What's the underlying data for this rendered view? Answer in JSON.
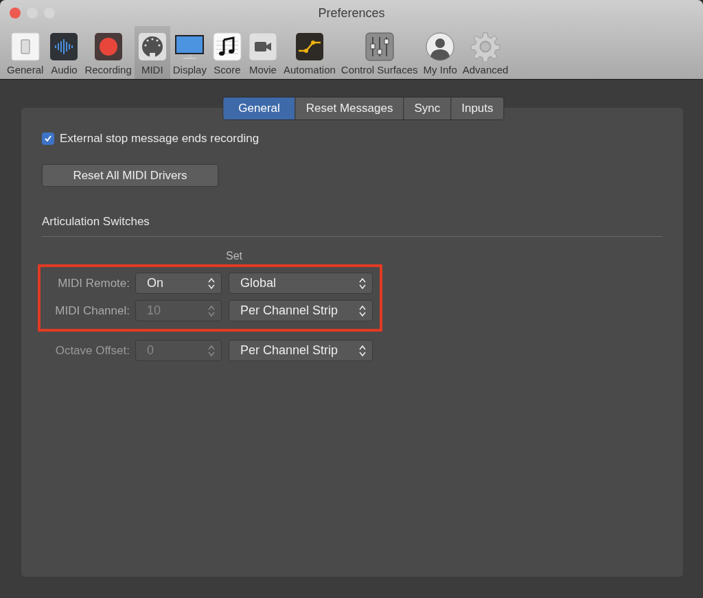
{
  "window": {
    "title": "Preferences"
  },
  "toolbar": [
    {
      "label": "General",
      "selected": false
    },
    {
      "label": "Audio",
      "selected": false
    },
    {
      "label": "Recording",
      "selected": false
    },
    {
      "label": "MIDI",
      "selected": true
    },
    {
      "label": "Display",
      "selected": false
    },
    {
      "label": "Score",
      "selected": false
    },
    {
      "label": "Movie",
      "selected": false
    },
    {
      "label": "Automation",
      "selected": false
    },
    {
      "label": "Control Surfaces",
      "selected": false
    },
    {
      "label": "My Info",
      "selected": false
    },
    {
      "label": "Advanced",
      "selected": false
    }
  ],
  "tabs": [
    {
      "label": "General",
      "selected": true
    },
    {
      "label": "Reset Messages",
      "selected": false
    },
    {
      "label": "Sync",
      "selected": false
    },
    {
      "label": "Inputs",
      "selected": false
    }
  ],
  "checkbox": {
    "label": "External stop message ends recording",
    "checked": true
  },
  "reset_button": "Reset All MIDI Drivers",
  "section": {
    "title": "Articulation Switches",
    "column_header": "Set",
    "rows": [
      {
        "label": "MIDI Remote:",
        "value": "On",
        "disabled": false,
        "set": "Global",
        "highlighted": true
      },
      {
        "label": "MIDI Channel:",
        "value": "10",
        "disabled": true,
        "set": "Per Channel Strip",
        "highlighted": true
      },
      {
        "label": "Octave Offset:",
        "value": "0",
        "disabled": true,
        "set": "Per Channel Strip",
        "highlighted": false
      }
    ]
  }
}
